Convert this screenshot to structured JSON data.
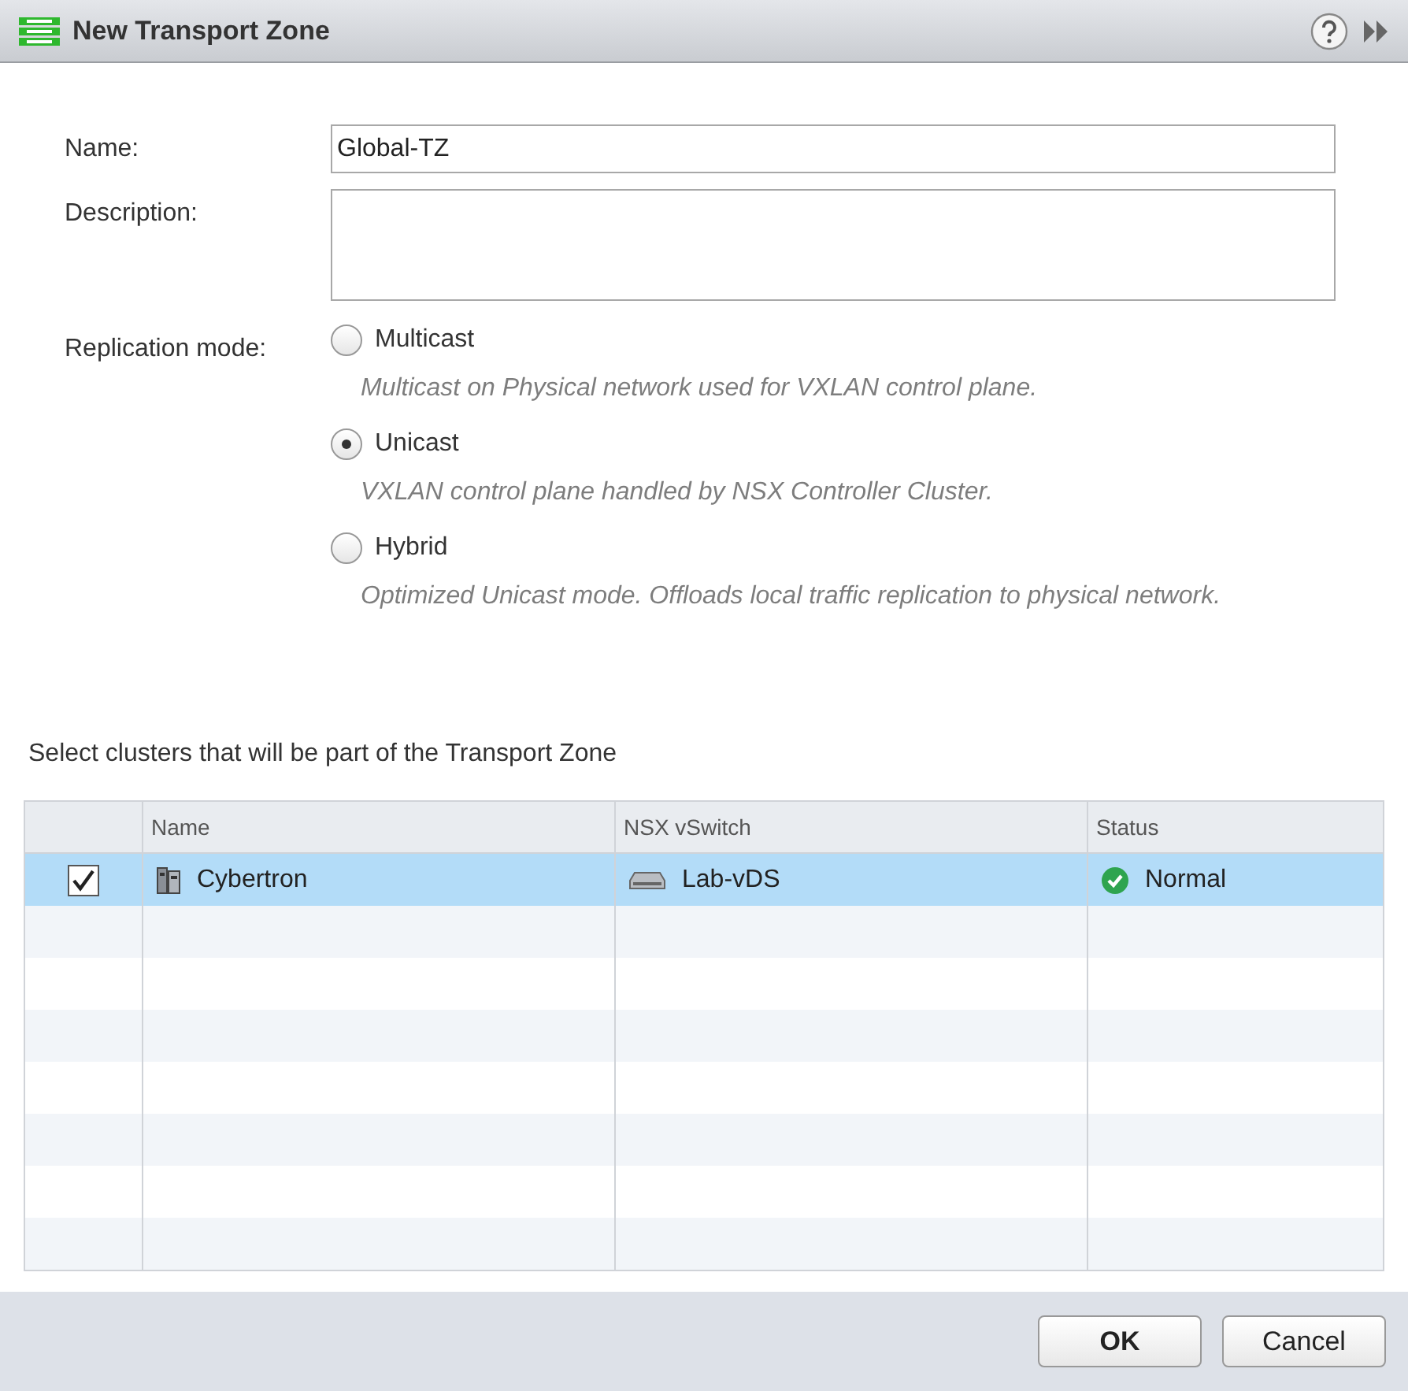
{
  "window": {
    "title": "New Transport Zone"
  },
  "form": {
    "name_label": "Name:",
    "name_value": "Global-TZ",
    "description_label": "Description:",
    "replication_label": "Replication mode:"
  },
  "replication_modes": [
    {
      "label": "Multicast",
      "description": "Multicast on Physical network used for VXLAN control plane.",
      "selected": false
    },
    {
      "label": "Unicast",
      "description": "VXLAN control plane handled by NSX Controller Cluster.",
      "selected": true
    },
    {
      "label": "Hybrid",
      "description": "Optimized Unicast mode. Offloads local traffic replication to physical network.",
      "selected": false
    }
  ],
  "clusters_caption": "Select clusters that will be part of the Transport Zone",
  "table": {
    "columns": [
      "Name",
      "NSX vSwitch",
      "Status"
    ],
    "rows": [
      {
        "checked": true,
        "selected": true,
        "name": "Cybertron",
        "vswitch": "Lab-vDS",
        "status": "Normal"
      }
    ]
  },
  "buttons": [
    {
      "label": "OK",
      "kind": "primary"
    },
    {
      "label": "Cancel",
      "kind": "secondary"
    }
  ]
}
